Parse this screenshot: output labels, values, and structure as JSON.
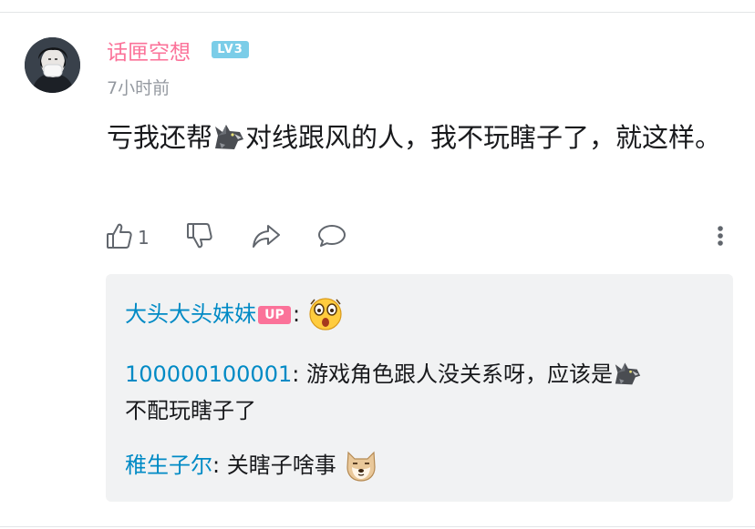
{
  "comment": {
    "username": "话匣空想",
    "level": "LV3",
    "time": "7小时前",
    "text_part1": "亏我还帮",
    "text_part2": "对线跟风的人，我不玩瞎子了，就这样。",
    "likes": "1"
  },
  "replies": [
    {
      "name": "大头大头妹妹",
      "badge": "UP",
      "sep": ":",
      "text": ""
    },
    {
      "name": "100000100001",
      "sep": ": ",
      "text_part1": "游戏角色跟人没关系呀，应该是",
      "text_part2": "不配玩瞎子了"
    },
    {
      "name": "稚生子尔",
      "sep": ": ",
      "text": "关瞎子啥事"
    }
  ],
  "colors": {
    "username": "#fb7299",
    "reply_name": "#008ac5",
    "level_badge": "#7bcde8",
    "up_badge": "#fb7299",
    "reply_bg": "#f1f2f3",
    "meta_gray": "#9499a0"
  },
  "icons": [
    "like-icon",
    "dislike-icon",
    "share-icon",
    "reply-comment-icon",
    "more-vertical-icon",
    "wolf-emoji-icon",
    "surprised-emoji-icon",
    "doge-emoji-icon"
  ]
}
